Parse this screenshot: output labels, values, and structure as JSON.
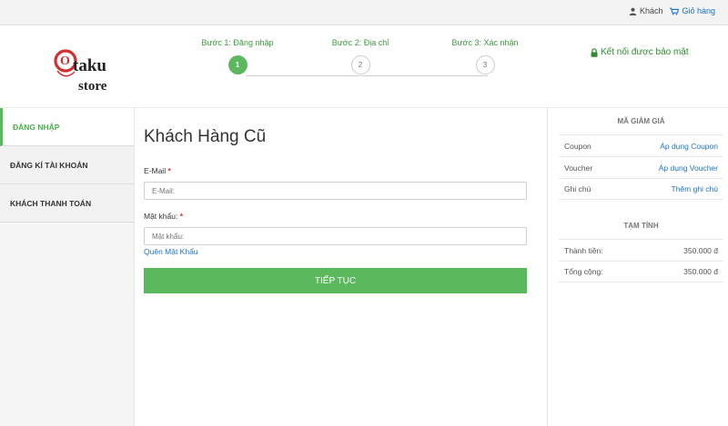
{
  "topbar": {
    "guest_label": "Khách",
    "cart_label": "Giỏ hàng"
  },
  "logo": {
    "line1": "taku",
    "line2": "store",
    "initial": "O"
  },
  "steps": [
    {
      "label": "Bước 1: Đăng nhập",
      "number": "1",
      "state": "active"
    },
    {
      "label": "Bước 2: Địa chỉ",
      "number": "2",
      "state": "pending"
    },
    {
      "label": "Bước 3: Xác nhận",
      "number": "3",
      "state": "pending"
    }
  ],
  "secure_label": "Kết nối được bảo mật",
  "sidebar": {
    "items": [
      {
        "label": "ĐĂNG NHẬP",
        "active": true
      },
      {
        "label": "ĐĂNG KÍ TÀI KHOẢN",
        "active": false
      },
      {
        "label": "KHÁCH THANH TOÁN",
        "active": false
      }
    ]
  },
  "form": {
    "title": "Khách Hàng Cũ",
    "email_label": "E-Mail",
    "email_placeholder": "E-Mail:",
    "password_label": "Mật khẩu:",
    "password_placeholder": "Mật khẩu:",
    "required_mark": "*",
    "forgot_label": "Quên Mật Khẩu",
    "submit_label": "TIẾP TỤC"
  },
  "discount": {
    "title": "MÃ GIẢM GIÁ",
    "rows": [
      {
        "key": "Coupon",
        "value": "Áp dụng Coupon"
      },
      {
        "key": "Voucher",
        "value": "Áp dụng Voucher"
      },
      {
        "key": "Ghi chú",
        "value": "Thêm ghi chú"
      }
    ]
  },
  "summary": {
    "title": "TẠM TÍNH",
    "rows": [
      {
        "key": "Thành tiền:",
        "value": "350.000 đ"
      },
      {
        "key": "Tổng cộng:",
        "value": "350.000 đ"
      }
    ]
  },
  "colors": {
    "accent_green": "#5cb85c",
    "link_blue": "#1a73c8",
    "logo_red": "#d32f2f"
  }
}
